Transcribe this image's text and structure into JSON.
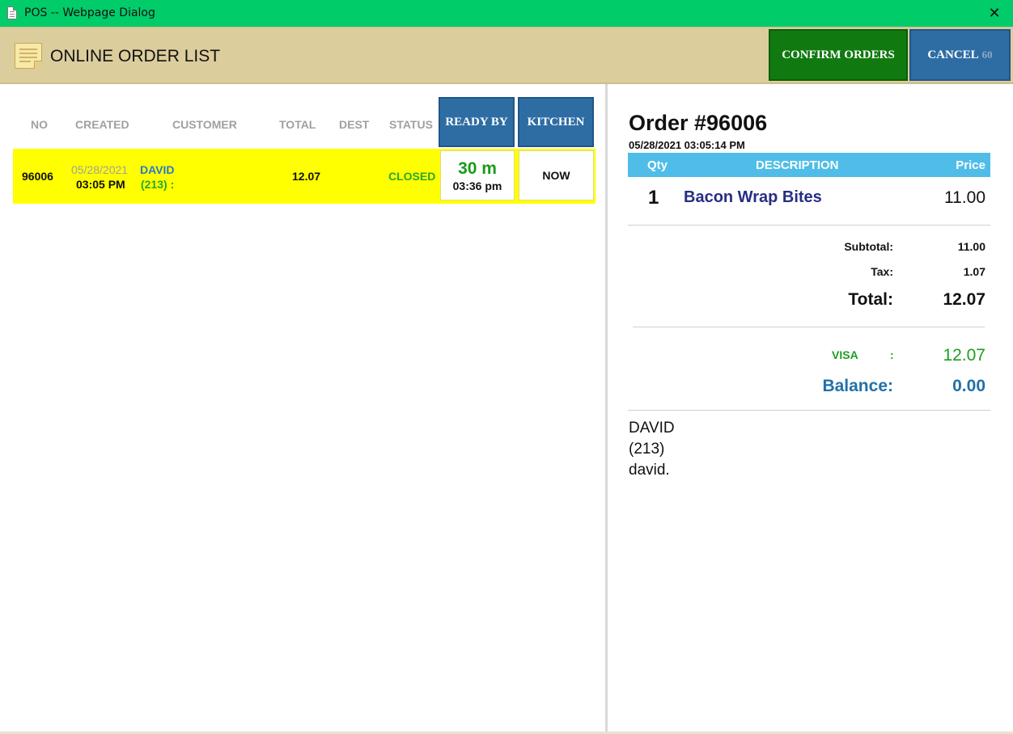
{
  "window": {
    "title": "POS -- Webpage Dialog"
  },
  "header": {
    "title": "ONLINE ORDER LIST",
    "confirm_label": "CONFIRM ORDERS",
    "cancel_label": "CANCEL",
    "cancel_countdown": "60"
  },
  "table": {
    "columns": {
      "no": "NO",
      "created": "CREATED",
      "customer": "CUSTOMER",
      "total": "TOTAL",
      "dest": "DEST",
      "status": "STATUS",
      "ready_by": "READY BY",
      "kitchen": "KITCHEN"
    },
    "rows": [
      {
        "no": "96006",
        "created_date": "05/28/2021",
        "created_time": "03:05 PM",
        "customer_name": "DAVID",
        "customer_phone": "(213) :",
        "total": "12.07",
        "dest": "",
        "status": "CLOSED",
        "ready_minutes": "30 m",
        "ready_time": "03:36 pm",
        "kitchen": "NOW"
      }
    ]
  },
  "detail": {
    "order_title": "Order #96006",
    "order_datetime": "05/28/2021 03:05:14 PM",
    "items_header": {
      "qty": "Qty",
      "description": "DESCRIPTION",
      "price": "Price"
    },
    "items": [
      {
        "qty": "1",
        "description": "Bacon Wrap Bites",
        "price": "11.00"
      }
    ],
    "subtotal_label": "Subtotal:",
    "subtotal": "11.00",
    "tax_label": "Tax:",
    "tax": "1.07",
    "total_label": "Total:",
    "total": "12.07",
    "payment_method": "VISA",
    "payment_colon": ":",
    "payment_amount": "12.07",
    "balance_label": "Balance:",
    "balance": "0.00",
    "customer_name": "DAVID",
    "customer_phone": "(213)",
    "customer_email": "david."
  },
  "colors": {
    "titlebar": "#00cc6a",
    "header_bg": "#dccd9d",
    "confirm_button": "#107a10",
    "cancel_button": "#2e6da4",
    "row_highlight": "#ffff00",
    "items_header": "#4fbde8"
  },
  "icons": {
    "window": "document-icon",
    "close": "close-icon",
    "header": "order-list-icon"
  }
}
